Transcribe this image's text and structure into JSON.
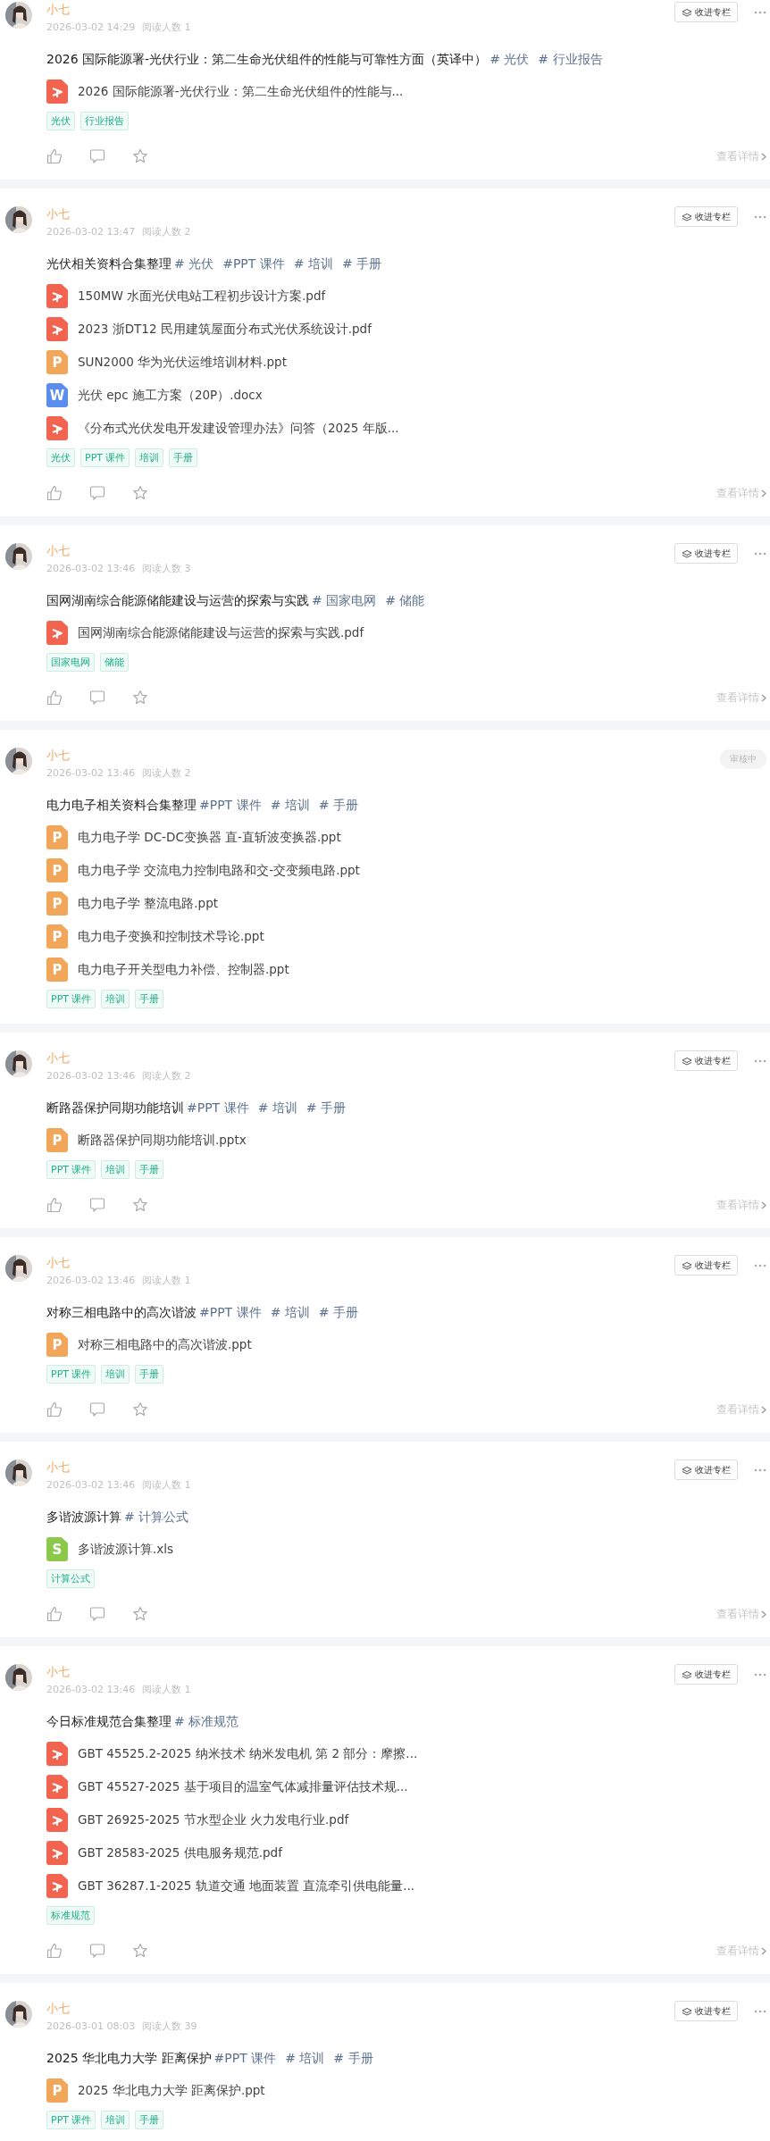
{
  "posts": [
    {
      "author": "小七",
      "date": "2026-03-02 14:29",
      "reads": "阅读人数 1",
      "status": {
        "kind": "button",
        "label": "收进专栏"
      },
      "title": "2026 国际能源署-光伏行业：第二生命光伏组件的性能与可靠性方面（英译中）",
      "hashtags": [
        "# 光伏",
        "# 行业报告"
      ],
      "files": [
        {
          "kind": "pdf",
          "name": "2026 国际能源署-光伏行业：第二生命光伏组件的性能与..."
        }
      ],
      "tags": [
        "光伏",
        "行业报告"
      ],
      "details": "查看详情"
    },
    {
      "author": "小七",
      "date": "2026-03-02 13:47",
      "reads": "阅读人数 2",
      "status": {
        "kind": "button",
        "label": "收进专栏"
      },
      "title": "光伏相关资料合集整理",
      "hashtags": [
        "# 光伏",
        "#PPT 课件",
        "# 培训",
        "# 手册"
      ],
      "files": [
        {
          "kind": "pdf",
          "name": "150MW 水面光伏电站工程初步设计方案.pdf"
        },
        {
          "kind": "pdf",
          "name": "2023 浙DT12 民用建筑屋面分布式光伏系统设计.pdf"
        },
        {
          "kind": "ppt",
          "letter": "P",
          "name": "SUN2000 华为光伏运维培训材料.ppt"
        },
        {
          "kind": "doc",
          "letter": "W",
          "name": "光伏 epc 施工方案（20P）.docx"
        },
        {
          "kind": "pdf",
          "name": "《分布式光伏发电开发建设管理办法》问答（2025 年版..."
        }
      ],
      "tags": [
        "光伏",
        "PPT 课件",
        "培训",
        "手册"
      ],
      "details": "查看详情"
    },
    {
      "author": "小七",
      "date": "2026-03-02 13:46",
      "reads": "阅读人数 3",
      "status": {
        "kind": "button",
        "label": "收进专栏"
      },
      "title": "国网湖南综合能源储能建设与运营的探索与实践",
      "hashtags": [
        "# 国家电网",
        "# 储能"
      ],
      "files": [
        {
          "kind": "pdf",
          "name": "国网湖南综合能源储能建设与运营的探索与实践.pdf"
        }
      ],
      "tags": [
        "国家电网",
        "储能"
      ],
      "details": "查看详情"
    },
    {
      "author": "小七",
      "date": "2026-03-02 13:46",
      "reads": "阅读人数 2",
      "status": {
        "kind": "pending",
        "label": "审核中"
      },
      "title": "电力电子相关资料合集整理",
      "hashtags": [
        "#PPT 课件",
        "# 培训",
        "# 手册"
      ],
      "files": [
        {
          "kind": "ppt",
          "letter": "P",
          "name": "电力电子学 DC-DC变换器 直-直斩波变换器.ppt"
        },
        {
          "kind": "ppt",
          "letter": "P",
          "name": "电力电子学 交流电力控制电路和交-交变频电路.ppt"
        },
        {
          "kind": "ppt",
          "letter": "P",
          "name": "电力电子学 整流电路.ppt"
        },
        {
          "kind": "ppt",
          "letter": "P",
          "name": "电力电子变换和控制技术导论.ppt"
        },
        {
          "kind": "ppt",
          "letter": "P",
          "name": "电力电子开关型电力补偿、控制器.ppt"
        }
      ],
      "tags": [
        "PPT 课件",
        "培训",
        "手册"
      ]
    },
    {
      "author": "小七",
      "date": "2026-03-02 13:46",
      "reads": "阅读人数 2",
      "status": {
        "kind": "button",
        "label": "收进专栏"
      },
      "title": "断路器保护同期功能培训",
      "hashtags": [
        "#PPT 课件",
        "# 培训",
        "# 手册"
      ],
      "files": [
        {
          "kind": "ppt",
          "letter": "P",
          "name": "断路器保护同期功能培训.pptx"
        }
      ],
      "tags": [
        "PPT 课件",
        "培训",
        "手册"
      ],
      "details": "查看详情"
    },
    {
      "author": "小七",
      "date": "2026-03-02 13:46",
      "reads": "阅读人数 1",
      "status": {
        "kind": "button",
        "label": "收进专栏"
      },
      "title": "对称三相电路中的高次谐波",
      "hashtags": [
        "#PPT 课件",
        "# 培训",
        "# 手册"
      ],
      "files": [
        {
          "kind": "ppt",
          "letter": "P",
          "name": "对称三相电路中的高次谐波.ppt"
        }
      ],
      "tags": [
        "PPT 课件",
        "培训",
        "手册"
      ],
      "details": "查看详情"
    },
    {
      "author": "小七",
      "date": "2026-03-02 13:46",
      "reads": "阅读人数 1",
      "status": {
        "kind": "button",
        "label": "收进专栏"
      },
      "title": "多谐波源计算",
      "hashtags": [
        "# 计算公式"
      ],
      "files": [
        {
          "kind": "xls",
          "letter": "S",
          "name": "多谐波源计算.xls"
        }
      ],
      "tags": [
        "计算公式"
      ],
      "details": "查看详情"
    },
    {
      "author": "小七",
      "date": "2026-03-02 13:46",
      "reads": "阅读人数 1",
      "status": {
        "kind": "button",
        "label": "收进专栏"
      },
      "title": "今日标准规范合集整理",
      "hashtags": [
        "# 标准规范"
      ],
      "files": [
        {
          "kind": "pdf",
          "name": "GBT 45525.2-2025 纳米技术 纳米发电机 第 2 部分：摩擦..."
        },
        {
          "kind": "pdf",
          "name": "GBT 45527-2025 基于项目的温室气体减排量评估技术规..."
        },
        {
          "kind": "pdf",
          "name": "GBT 26925-2025 节水型企业 火力发电行业.pdf"
        },
        {
          "kind": "pdf",
          "name": "GBT 28583-2025 供电服务规范.pdf"
        },
        {
          "kind": "pdf",
          "name": "GBT 36287.1-2025 轨道交通 地面装置 直流牵引供电能量..."
        }
      ],
      "tags": [
        "标准规范"
      ],
      "details": "查看详情"
    },
    {
      "author": "小七",
      "date": "2026-03-01 08:03",
      "reads": "阅读人数 39",
      "status": {
        "kind": "button",
        "label": "收进专栏"
      },
      "title": "2025 华北电力大学 距离保护",
      "hashtags": [
        "#PPT 课件",
        "# 培训",
        "# 手册"
      ],
      "files": [
        {
          "kind": "ppt",
          "letter": "P",
          "name": "2025 华北电力大学 距离保护.ppt"
        }
      ],
      "tags": [
        "PPT 课件",
        "培训",
        "手册"
      ]
    }
  ]
}
